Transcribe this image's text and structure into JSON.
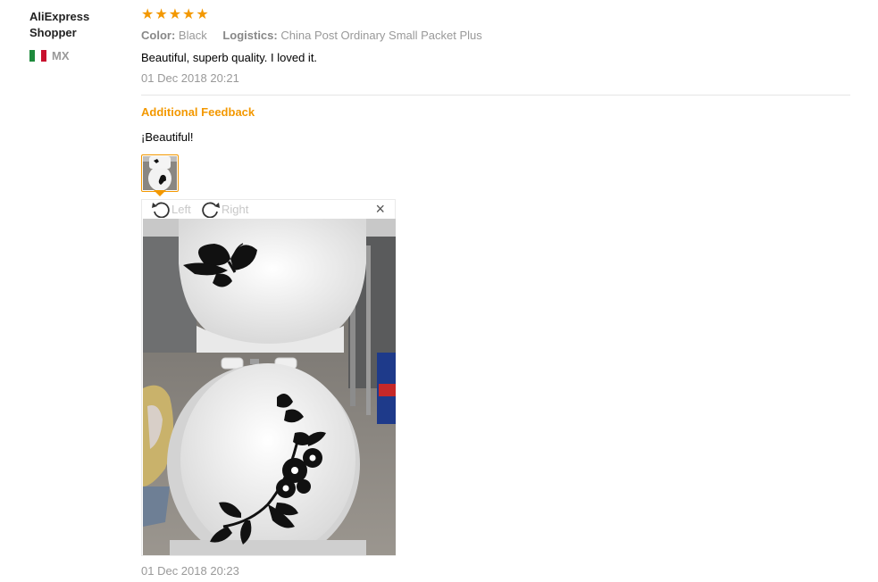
{
  "buyer": {
    "name": "AliExpress Shopper",
    "country": "MX",
    "flag_colors": [
      "#1e8a3c",
      "#ffffff",
      "#c8102e"
    ]
  },
  "review": {
    "rating": 5,
    "rating_max": 5,
    "star_color": "#f39800",
    "color_label": "Color:",
    "color_value": "Black",
    "logistics_label": "Logistics:",
    "logistics_value": "China Post Ordinary Small Packet Plus",
    "text": "Beautiful, superb quality. I loved it.",
    "date": "01 Dec 2018 20:21"
  },
  "additional_feedback": {
    "heading": "Additional Feedback",
    "text": "¡Beautiful!",
    "date": "01 Dec 2018 20:23",
    "accent_color": "#f39800"
  },
  "image_viewer": {
    "rotate_left_label": "Left",
    "rotate_right_label": "Right",
    "close_icon": "close-icon",
    "image_subject": "toilet-with-black-butterfly-and-flower-decals"
  }
}
